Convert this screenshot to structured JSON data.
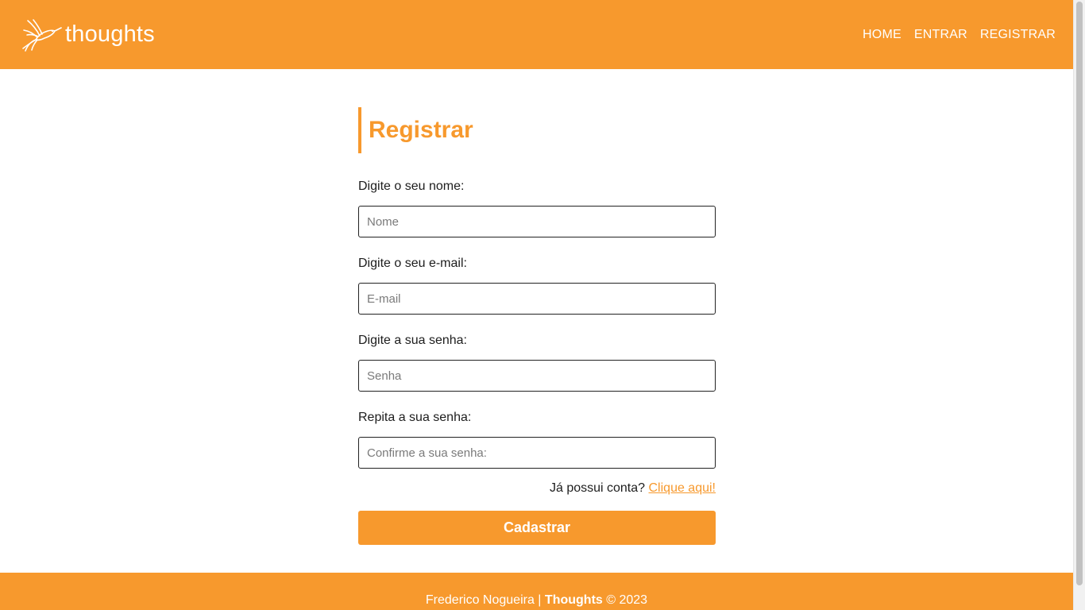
{
  "colors": {
    "accent": "#f7992d",
    "text": "#1d1d1d",
    "background": "#ffffff",
    "input_border": "#222222",
    "placeholder": "#7a7a7a"
  },
  "navbar": {
    "brand_name": "thoughts",
    "brand_icon": "hummingbird-logo-icon",
    "links": [
      {
        "label": "HOME"
      },
      {
        "label": "ENTRAR"
      },
      {
        "label": "REGISTRAR"
      }
    ]
  },
  "main": {
    "title": "Registrar",
    "fields": [
      {
        "label": "Digite o seu nome:",
        "placeholder": "Nome",
        "value": ""
      },
      {
        "label": "Digite o seu e-mail:",
        "placeholder": "E-mail",
        "value": ""
      },
      {
        "label": "Digite a sua senha:",
        "placeholder": "Senha",
        "value": ""
      },
      {
        "label": "Repita a sua senha:",
        "placeholder": "Confirme a sua senha:",
        "value": ""
      }
    ],
    "login_prompt": "Já possui conta?",
    "login_link": "Clique aqui!",
    "submit_label": "Cadastrar"
  },
  "footer": {
    "author": "Frederico Nogueira |",
    "brand": "Thoughts",
    "copyright": "© 2023"
  }
}
